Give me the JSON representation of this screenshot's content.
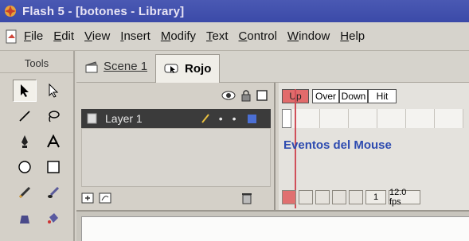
{
  "window": {
    "title": "Flash 5 - [botones - Library]"
  },
  "menubar": {
    "items": [
      {
        "underline": "F",
        "rest": "ile"
      },
      {
        "underline": "E",
        "rest": "dit"
      },
      {
        "underline": "V",
        "rest": "iew"
      },
      {
        "underline": "I",
        "rest": "nsert"
      },
      {
        "underline": "M",
        "rest": "odify"
      },
      {
        "underline": "T",
        "rest": "ext"
      },
      {
        "underline": "C",
        "rest": "ontrol"
      },
      {
        "underline": "W",
        "rest": "indow"
      },
      {
        "underline": "H",
        "rest": "elp"
      }
    ]
  },
  "tools": {
    "label": "Tools",
    "icons": [
      "arrow-icon",
      "subselect-icon",
      "line-icon",
      "lasso-icon",
      "pen-icon",
      "text-icon",
      "oval-icon",
      "rectangle-icon",
      "pencil-icon",
      "brush-icon",
      "ink-bottle-icon",
      "paint-bucket-icon"
    ]
  },
  "scenebar": {
    "scene": "Scene 1",
    "symbol": "Rojo"
  },
  "timeline": {
    "layer_name": "Layer 1",
    "frame_labels": [
      "Up",
      "Over",
      "Down",
      "Hit"
    ],
    "frame_text": "Eventos del Mouse",
    "current_frame": "1",
    "fps": "12.0 fps"
  }
}
